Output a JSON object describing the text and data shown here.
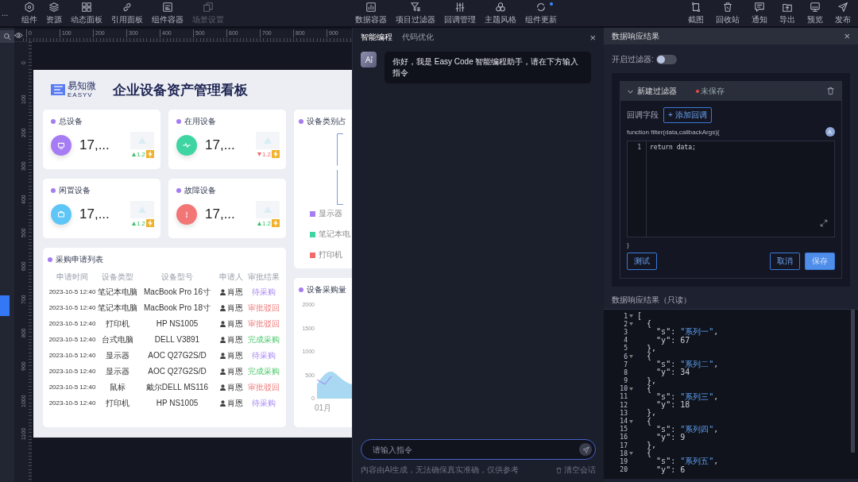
{
  "toolbar": {
    "more": "...",
    "left": [
      {
        "label": "组件",
        "disabled": false
      },
      {
        "label": "资源",
        "disabled": false
      },
      {
        "label": "动态面板",
        "disabled": false
      },
      {
        "label": "引用面板",
        "disabled": false
      },
      {
        "label": "组件容器",
        "disabled": false
      },
      {
        "label": "场景设置",
        "disabled": true
      }
    ],
    "center": [
      {
        "label": "数据容器",
        "badge": false
      },
      {
        "label": "项目过滤器",
        "badge": false
      },
      {
        "label": "回调管理",
        "badge": false
      },
      {
        "label": "主题风格",
        "badge": false
      },
      {
        "label": "组件更新",
        "badge": true
      }
    ],
    "right": [
      "截图",
      "回收站",
      "通知",
      "导出",
      "预览",
      "发布"
    ]
  },
  "canvas": {
    "h_ruler": [
      "0",
      "100",
      "200",
      "300",
      "400",
      "500",
      "600",
      "700",
      "800",
      "900"
    ],
    "v_ruler": [
      "0",
      "100",
      "200",
      "300",
      "400",
      "500",
      "600",
      "700",
      "800",
      "900",
      "1000",
      "1100"
    ]
  },
  "dashboard": {
    "logo_name": "易知微",
    "logo_sub": "EASYV",
    "title": "企业设备资产管理看板",
    "stats": [
      {
        "label": "总设备",
        "value": "17,...",
        "rising": true,
        "change": "1.2",
        "color": "#a67cf4"
      },
      {
        "label": "在用设备",
        "value": "17,...",
        "rising": false,
        "change": "1.2",
        "color": "#3fd5a3"
      },
      {
        "label": "闲置设备",
        "value": "17,...",
        "rising": true,
        "change": "1.2",
        "color": "#5ec6f7"
      },
      {
        "label": "故障设备",
        "value": "17,...",
        "rising": true,
        "change": "1.2",
        "color": "#f27676"
      }
    ],
    "table": {
      "title": "采购申请列表",
      "columns": [
        "申请时间",
        "设备类型",
        "设备型号",
        "申请人",
        "审批结果"
      ],
      "rows": [
        {
          "time": "2023-10-5 12:40",
          "type": "笔记本电脑",
          "model": "MacBook Pro 16寸",
          "applicant": "肖恩",
          "result": "待采购",
          "kind": "pending"
        },
        {
          "time": "2023-10-5 12:40",
          "type": "笔记本电脑",
          "model": "MacBook Pro 18寸",
          "applicant": "肖恩",
          "result": "审批驳回",
          "kind": "rejected"
        },
        {
          "time": "2023-10-5 12:40",
          "type": "打印机",
          "model": "HP NS1005",
          "applicant": "肖恩",
          "result": "审批驳回",
          "kind": "rejected"
        },
        {
          "time": "2023-10-5 12:40",
          "type": "台式电脑",
          "model": "DELL V3891",
          "applicant": "肖恩",
          "result": "完成采购",
          "kind": "done"
        },
        {
          "time": "2023-10-5 12:40",
          "type": "显示器",
          "model": "AOC Q27G2S/D",
          "applicant": "肖恩",
          "result": "待采购",
          "kind": "pending"
        },
        {
          "time": "2023-10-5 12:40",
          "type": "显示器",
          "model": "AOC Q27G2S/D",
          "applicant": "肖恩",
          "result": "完成采购",
          "kind": "done"
        },
        {
          "time": "2023-10-5 12:40",
          "type": "鼠标",
          "model": "戴尔DELL MS116",
          "applicant": "肖恩",
          "result": "审批驳回",
          "kind": "rejected"
        },
        {
          "time": "2023-10-5 12:40",
          "type": "打印机",
          "model": "HP NS1005",
          "applicant": "肖恩",
          "result": "待采购",
          "kind": "pending"
        }
      ]
    },
    "category_card": {
      "title": "设备类别占",
      "legend": [
        {
          "label": "显示器",
          "color": "#a67cf4"
        },
        {
          "label": "笔记本电",
          "color": "#3fd5a3"
        },
        {
          "label": "打印机",
          "color": "#f06a6a"
        }
      ]
    },
    "purchase_card": {
      "title": "设备采购量",
      "y_labels": [
        "2000",
        "1500",
        "1000",
        "500",
        "0"
      ],
      "x_label": "01月"
    }
  },
  "chat": {
    "tabs": [
      {
        "label": "智能编程",
        "selected": true
      },
      {
        "label": "代码优化",
        "selected": false
      }
    ],
    "close": "×",
    "message": "你好，我是 Easy Code 智能编程助手，请在下方输入指令",
    "input": {
      "placeholder": "请输入指令"
    },
    "disclaimer": "内容由AI生成，无法确保真实准确，仅供参考",
    "clear": "清空会话"
  },
  "response_panel": {
    "title": "数据响应结果",
    "close": "×",
    "filter_toggle": {
      "label": "开启过滤器:",
      "on": false
    },
    "filter": {
      "name": "新建过滤器",
      "expanded": true,
      "saved": false,
      "status": "未保存",
      "callback_label": "回调字段",
      "add_callback": "+ 添加回调",
      "signature": "function filter(data,callbackArgs){",
      "code": [
        {
          "number": "1",
          "text": "return data;"
        }
      ],
      "closing": "}",
      "buttons": [
        {
          "label": "测试",
          "kind": "outline"
        },
        {
          "label": "取消",
          "kind": "outline"
        },
        {
          "label": "保存",
          "kind": "primary"
        }
      ]
    },
    "result_label": "数据响应结果（只读）",
    "result_lines": [
      {
        "number": "1",
        "text": "[",
        "foldable": true
      },
      {
        "number": "2",
        "text": "  {",
        "foldable": true
      },
      {
        "number": "3",
        "text": "    \"s\": \"系列一\",",
        "foldable": false
      },
      {
        "number": "4",
        "text": "    \"y\": 67",
        "foldable": false
      },
      {
        "number": "5",
        "text": "  },",
        "foldable": false
      },
      {
        "number": "6",
        "text": "  {",
        "foldable": true
      },
      {
        "number": "7",
        "text": "    \"s\": \"系列二\",",
        "foldable": false
      },
      {
        "number": "8",
        "text": "    \"y\": 34",
        "foldable": false
      },
      {
        "number": "9",
        "text": "  },",
        "foldable": false
      },
      {
        "number": "10",
        "text": "  {",
        "foldable": true
      },
      {
        "number": "11",
        "text": "    \"s\": \"系列三\",",
        "foldable": false
      },
      {
        "number": "12",
        "text": "    \"y\": 18",
        "foldable": false
      },
      {
        "number": "13",
        "text": "  },",
        "foldable": false
      },
      {
        "number": "14",
        "text": "  {",
        "foldable": true
      },
      {
        "number": "15",
        "text": "    \"s\": \"系列四\",",
        "foldable": false
      },
      {
        "number": "16",
        "text": "    \"y\": 9",
        "foldable": false
      },
      {
        "number": "17",
        "text": "  },",
        "foldable": false
      },
      {
        "number": "18",
        "text": "  {",
        "foldable": true
      },
      {
        "number": "19",
        "text": "    \"s\": \"系列五\",",
        "foldable": false
      },
      {
        "number": "20",
        "text": "    \"y\": 6",
        "foldable": false
      }
    ]
  }
}
